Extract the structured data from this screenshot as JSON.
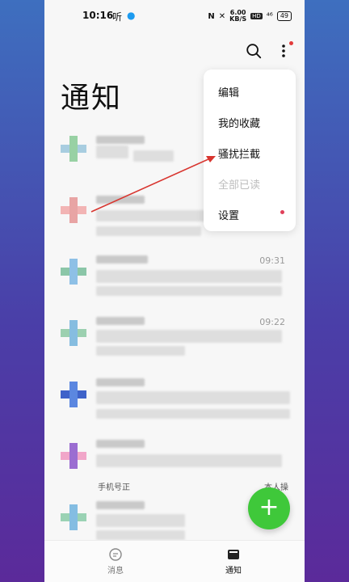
{
  "status_bar": {
    "time": "10:16",
    "app_label": "听",
    "net_speed_top": "6.00",
    "net_speed_bottom": "KB/S",
    "hd": "HD",
    "signal": "⁴⁶",
    "battery": "49"
  },
  "page": {
    "title": "通知"
  },
  "menu": {
    "items": [
      {
        "label": "编辑",
        "disabled": false
      },
      {
        "label": "我的收藏",
        "disabled": false
      },
      {
        "label": "骚扰拦截",
        "disabled": false
      },
      {
        "label": "全部已读",
        "disabled": true
      },
      {
        "label": "设置",
        "disabled": false
      }
    ]
  },
  "list": {
    "rows": [
      {
        "time": ""
      },
      {
        "time": ""
      },
      {
        "time": "09:31"
      },
      {
        "time": "09:22"
      },
      {
        "time": ""
      },
      {
        "time": "",
        "snippet": "手机号正",
        "snippet_right": "本人操"
      },
      {
        "time": ""
      }
    ]
  },
  "fab": {
    "label": "+"
  },
  "bottom_nav": {
    "messages_label": "消息",
    "notifications_label": "通知"
  },
  "colors": {
    "accent_green": "#3fc83a",
    "badge_red": "#e23b3b"
  }
}
